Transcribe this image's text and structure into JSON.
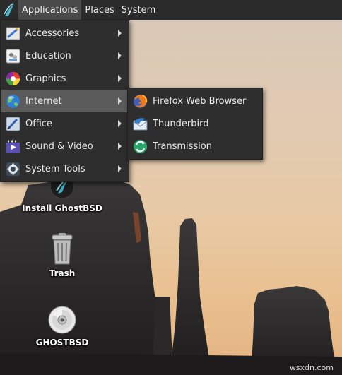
{
  "panel": {
    "applications_label": "Applications",
    "places_label": "Places",
    "system_label": "System"
  },
  "main_menu": {
    "items": [
      {
        "label": "Accessories",
        "icon": "accessories-icon"
      },
      {
        "label": "Education",
        "icon": "education-icon"
      },
      {
        "label": "Graphics",
        "icon": "graphics-icon"
      },
      {
        "label": "Internet",
        "icon": "internet-icon"
      },
      {
        "label": "Office",
        "icon": "office-icon"
      },
      {
        "label": "Sound & Video",
        "icon": "sound-video-icon"
      },
      {
        "label": "System Tools",
        "icon": "system-tools-icon"
      }
    ],
    "active_item": "Internet"
  },
  "internet_submenu": {
    "items": [
      {
        "label": "Firefox Web Browser",
        "icon": "firefox-icon"
      },
      {
        "label": "Thunderbird",
        "icon": "thunderbird-icon"
      },
      {
        "label": "Transmission",
        "icon": "transmission-icon"
      }
    ]
  },
  "desktop_icons": [
    {
      "label": "Install GhostBSD",
      "icon": "ghostbsd-installer-icon"
    },
    {
      "label": "Trash",
      "icon": "trash-icon"
    },
    {
      "label": "GHOSTBSD",
      "icon": "disc-icon"
    }
  ],
  "watermark": "wsxdn.com",
  "colors": {
    "panel_bg": "#2b2b2b",
    "menu_bg": "#2e2e2e",
    "menu_hover": "#5b5b5b",
    "text": "#ececec"
  }
}
